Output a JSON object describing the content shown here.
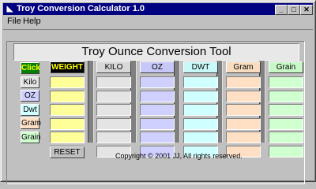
{
  "window": {
    "title": "Troy Conversion Calculator 1.0"
  },
  "menu": [
    {
      "label": "File"
    },
    {
      "label": "Help"
    }
  ],
  "banner": "Troy Ounce Conversion Tool",
  "columns": [
    {
      "label": "WEIGHT",
      "bg": "#000000",
      "fg": "#ffff00",
      "cell": "#ffff99"
    },
    {
      "label": "KILO",
      "bg": "#d8d8d8",
      "fg": "#000000",
      "cell": "#e4e4e4"
    },
    {
      "label": "OZ",
      "bg": "#c8c8f8",
      "fg": "#000000",
      "cell": "#d0d0ff"
    },
    {
      "label": "DWT",
      "bg": "#c8f8f8",
      "fg": "#000000",
      "cell": "#d0ffff"
    },
    {
      "label": "Gram",
      "bg": "#f8dcc0",
      "fg": "#000000",
      "cell": "#ffe0c4"
    },
    {
      "label": "Grain",
      "bg": "#c8f8c8",
      "fg": "#000000",
      "cell": "#d0ffd0"
    }
  ],
  "row_labels": [
    {
      "label": "Click",
      "bg": "#008000",
      "fg": "#ffff00"
    },
    {
      "label": "Kilo",
      "bg": "#e4e4e4",
      "fg": "#000000"
    },
    {
      "label": "OZ",
      "bg": "#d0d0ff",
      "fg": "#000000"
    },
    {
      "label": "Dwt",
      "bg": "#d0ffff",
      "fg": "#000000"
    },
    {
      "label": "Gram",
      "bg": "#ffe0c4",
      "fg": "#000000"
    },
    {
      "label": "Grain",
      "bg": "#d0ffd0",
      "fg": "#000000"
    }
  ],
  "reset_label": "RESET",
  "copyright": "Copyright © 2001 JJ, All rights reserved."
}
